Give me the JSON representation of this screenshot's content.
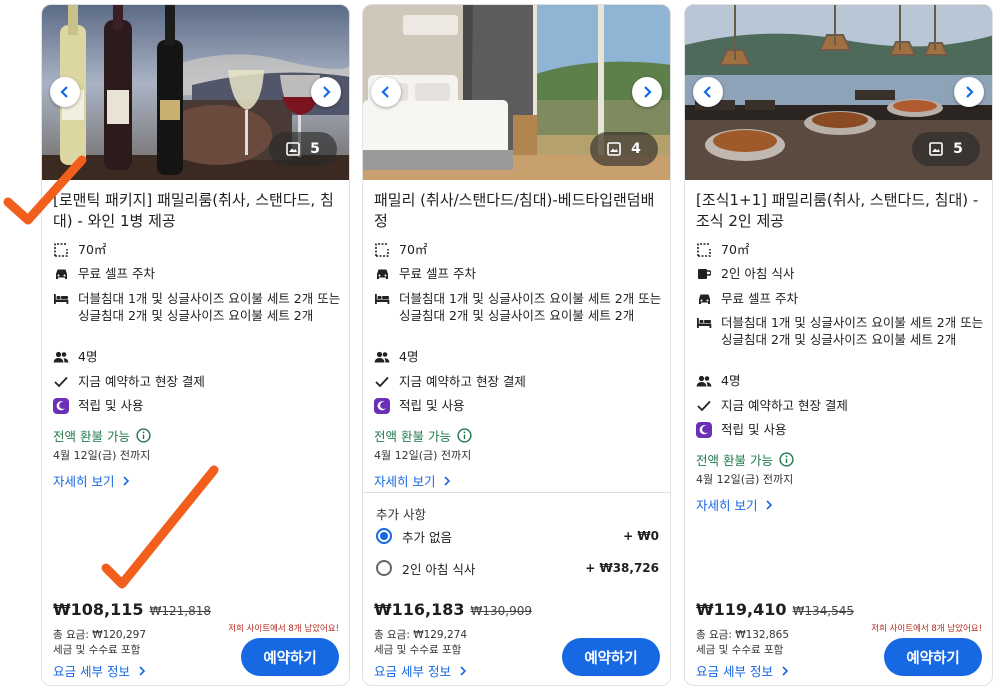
{
  "colors": {
    "accent": "#1668e3",
    "refund": "#227950",
    "scarcity": "#b3261e",
    "annotation": "#f25f1c"
  },
  "cards": [
    {
      "photo_count": "5",
      "title": "[로맨틱 패키지] 패밀리룸(취사, 스탠다드, 침대) - 와인 1병 제공",
      "features": [
        {
          "icon": "floor-plan-icon",
          "text": "70㎡"
        },
        {
          "icon": "car-icon",
          "text": "무료 셀프 주차"
        },
        {
          "icon": "bed-icon",
          "text": "더블침대 1개 및 싱글사이즈 요이불 세트 2개 또는 싱글침대 2개 및 싱글사이즈 요이불 세트 2개"
        },
        {
          "icon": "people-icon",
          "text": "4명"
        },
        {
          "icon": "check-icon",
          "text": "지금 예약하고 현장 결제"
        },
        {
          "icon": "rewards-icon",
          "text": "적립 및 사용"
        }
      ],
      "refund": "전액 환불 가능",
      "deadline": "4월 12일(금) 전까지",
      "details_link": "자세히 보기",
      "price_now": "₩108,115",
      "price_was": "₩121,818",
      "scarcity": "저희 사이트에서 8개 남았어요!",
      "total": "총 요금: ₩120,297",
      "taxes": "세금 및 수수료 포함",
      "price_details": "요금 세부 정보",
      "reserve": "예약하기"
    },
    {
      "photo_count": "4",
      "title": "패밀리 (취사/스탠다드/침대)-베드타입랜덤배정",
      "features": [
        {
          "icon": "floor-plan-icon",
          "text": "70㎡"
        },
        {
          "icon": "car-icon",
          "text": "무료 셀프 주차"
        },
        {
          "icon": "bed-icon",
          "text": "더블침대 1개 및 싱글사이즈 요이불 세트 2개 또는 싱글침대 2개 및 싱글사이즈 요이불 세트 2개"
        },
        {
          "icon": "people-icon",
          "text": "4명"
        },
        {
          "icon": "check-icon",
          "text": "지금 예약하고 현장 결제"
        },
        {
          "icon": "rewards-icon",
          "text": "적립 및 사용"
        }
      ],
      "refund": "전액 환불 가능",
      "deadline": "4월 12일(금) 전까지",
      "details_link": "자세히 보기",
      "extras_label": "추가 사항",
      "options": [
        {
          "label": "추가 없음",
          "price": "+ ₩0",
          "selected": true
        },
        {
          "label": "2인 아침 식사",
          "price": "+ ₩38,726",
          "selected": false
        }
      ],
      "price_now": "₩116,183",
      "price_was": "₩130,909",
      "total": "총 요금: ₩129,274",
      "taxes": "세금 및 수수료 포함",
      "price_details": "요금 세부 정보",
      "reserve": "예약하기"
    },
    {
      "photo_count": "5",
      "title": "[조식1+1] 패밀리룸(취사, 스탠다드, 침대) - 조식 2인 제공",
      "features": [
        {
          "icon": "floor-plan-icon",
          "text": "70㎡"
        },
        {
          "icon": "coffee-cup-icon",
          "text": "2인 아침 식사"
        },
        {
          "icon": "car-icon",
          "text": "무료 셀프 주차"
        },
        {
          "icon": "bed-icon",
          "text": "더블침대 1개 및 싱글사이즈 요이불 세트 2개 또는 싱글침대 2개 및 싱글사이즈 요이불 세트 2개"
        },
        {
          "icon": "people-icon",
          "text": "4명"
        },
        {
          "icon": "check-icon",
          "text": "지금 예약하고 현장 결제"
        },
        {
          "icon": "rewards-icon",
          "text": "적립 및 사용"
        }
      ],
      "refund": "전액 환불 가능",
      "deadline": "4월 12일(금) 전까지",
      "details_link": "자세히 보기",
      "price_now": "₩119,410",
      "price_was": "₩134,545",
      "scarcity": "저희 사이트에서 8개 남았어요!",
      "total": "총 요금: ₩132,865",
      "taxes": "세금 및 수수료 포함",
      "price_details": "요금 세부 정보",
      "reserve": "예약하기"
    }
  ]
}
